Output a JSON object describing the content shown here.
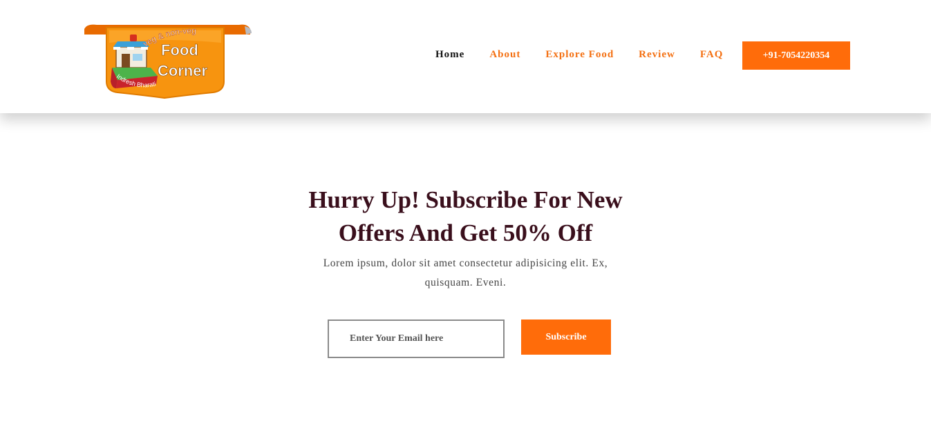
{
  "brand": {
    "logo_top_text": "veg & non-veg",
    "logo_main_1": "Food",
    "logo_main_2": "Corner",
    "logo_ribbon": "Indresh Bharati"
  },
  "nav": {
    "items": [
      {
        "label": "Home"
      },
      {
        "label": "About"
      },
      {
        "label": "Explore Food"
      },
      {
        "label": "Review"
      },
      {
        "label": "FAQ"
      }
    ],
    "phone_label": "+91-7054220354"
  },
  "subscribe": {
    "title_line1": "Hurry Up! Subscribe For New",
    "title_line2": "Offers And Get 50% Off",
    "desc_line1": "Lorem ipsum, dolor sit amet consectetur adipisicing elit. Ex,",
    "desc_line2": "quisquam. Eveni.",
    "email_placeholder": "Enter Your Email here",
    "button_label": "Subscribe"
  },
  "colors": {
    "accent": "#ff6c0a",
    "nav_link": "#f47012",
    "heading": "#3a0f1c"
  }
}
